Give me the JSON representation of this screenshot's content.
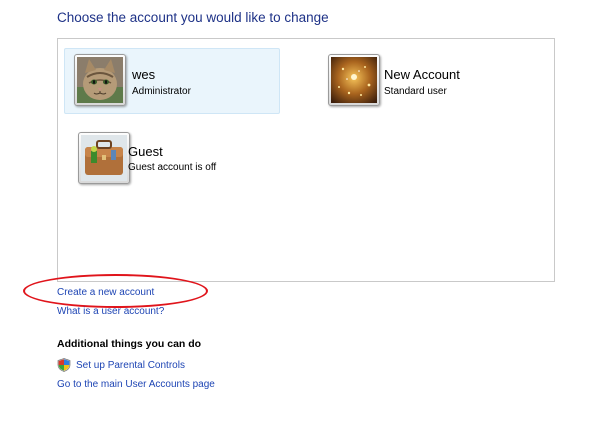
{
  "title": "Choose the account you would like to change",
  "accounts": [
    {
      "name": "wes",
      "type": "Administrator",
      "picture": "kitten-photo",
      "selected": true
    },
    {
      "name": "New Account",
      "type": "Standard user",
      "picture": "sparkle-photo",
      "selected": false
    },
    {
      "name": "Guest",
      "type": "Guest account is off",
      "picture": "briefcase-photo",
      "selected": false
    }
  ],
  "links": {
    "create": "Create a new account",
    "what_is": "What is a user account?"
  },
  "additional": {
    "heading": "Additional things you can do",
    "parental_controls": "Set up Parental Controls",
    "parental_icon": "security-shield-icon",
    "main_page": "Go to the main User Accounts page"
  },
  "colors": {
    "title": "#1e3287",
    "link": "#1e45b4",
    "annotation": "#e0141b",
    "selected_bg": "#eaf5fc"
  }
}
